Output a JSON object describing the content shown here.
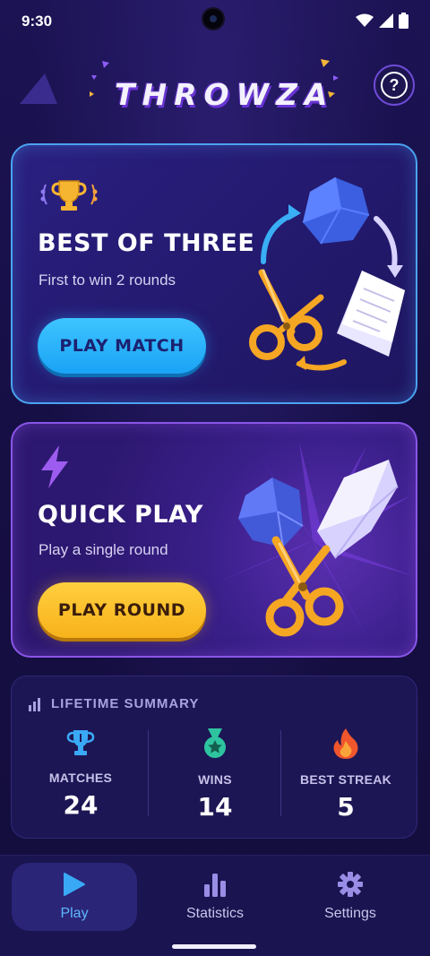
{
  "status_bar": {
    "time": "9:30"
  },
  "header": {
    "app_title": "THROWZA",
    "help_label": "?"
  },
  "best_of_three": {
    "title": "BEST OF THREE",
    "subtitle": "First to win 2 rounds",
    "button_label": "PLAY MATCH"
  },
  "quick_play": {
    "title": "QUICK PLAY",
    "subtitle": "Play a single round",
    "button_label": "PLAY ROUND"
  },
  "summary": {
    "title": "LIFETIME SUMMARY",
    "stats": [
      {
        "label": "MATCHES",
        "value": "24",
        "icon": "trophy-icon"
      },
      {
        "label": "WINS",
        "value": "14",
        "icon": "medal-icon"
      },
      {
        "label": "BEST STREAK",
        "value": "5",
        "icon": "flame-icon"
      }
    ]
  },
  "nav": {
    "items": [
      {
        "label": "Play",
        "icon": "play-icon",
        "active": true
      },
      {
        "label": "Statistics",
        "icon": "bar-chart-icon",
        "active": false
      },
      {
        "label": "Settings",
        "icon": "gear-icon",
        "active": false
      }
    ]
  },
  "colors": {
    "accent_blue": "#3ec4ff",
    "accent_yellow": "#f7b21b",
    "background": "#160f45",
    "card_border_blue": "#4aa3f0",
    "card_border_purple": "#8a55e8"
  }
}
